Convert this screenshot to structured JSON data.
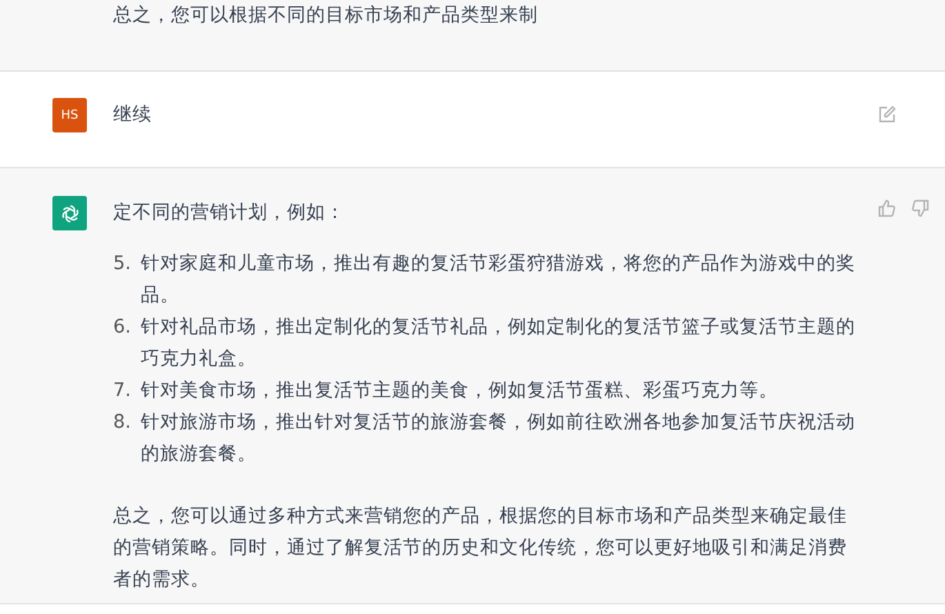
{
  "messages": [
    {
      "kind": "partial",
      "text": "总之，您可以根据不同的目标市场和产品类型来制"
    },
    {
      "kind": "user",
      "avatar": "HS",
      "text": "继续"
    },
    {
      "kind": "assistant",
      "intro": "定不同的营销计划，例如：",
      "list": [
        {
          "number": "5.",
          "text": "针对家庭和儿童市场，推出有趣的复活节彩蛋狩猎游戏，将您的产品作为游戏中的奖品。"
        },
        {
          "number": "6.",
          "text": "针对礼品市场，推出定制化的复活节礼品，例如定制化的复活节篮子或复活节主题的巧克力礼盒。"
        },
        {
          "number": "7.",
          "text": "针对美食市场，推出复活节主题的美食，例如复活节蛋糕、彩蛋巧克力等。"
        },
        {
          "number": "8.",
          "text": "针对旅游市场，推出针对复活节的旅游套餐，例如前往欧洲各地参加复活节庆祝活动的旅游套餐。"
        }
      ],
      "summary": "总之，您可以通过多种方式来营销您的产品，根据您的目标市场和产品类型来确定最佳的营销策略。同时，通过了解复活节的历史和文化传统，您可以更好地吸引和满足消费者的需求。"
    }
  ]
}
